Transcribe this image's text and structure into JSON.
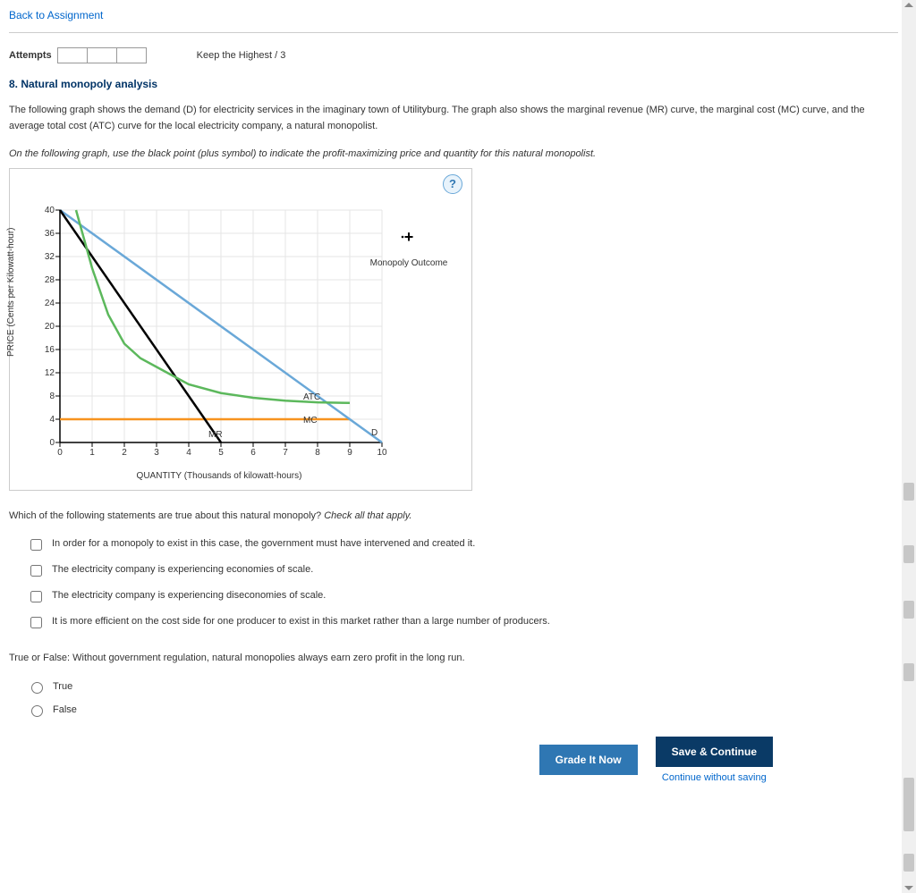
{
  "nav": {
    "back_link": "Back to Assignment"
  },
  "attempts": {
    "label": "Attempts",
    "keep_highest": "Keep the Highest / 3"
  },
  "question": {
    "title": "8. Natural monopoly analysis",
    "para1": "The following graph shows the demand (D) for electricity services in the imaginary town of Utilityburg. The graph also shows the marginal revenue (MR) curve, the marginal cost (MC) curve, and the average total cost (ATC) curve for the local electricity company, a natural monopolist.",
    "instruction": "On the following graph, use the black point (plus symbol) to indicate the profit-maximizing price and quantity for this natural monopolist."
  },
  "chart": {
    "help_symbol": "?",
    "y_label": "PRICE (Cents per Kilowatt-hour)",
    "x_label": "QUANTITY (Thousands of kilowatt-hours)",
    "legend_symbol": "+",
    "legend_label": "Monopoly Outcome",
    "curve_labels": {
      "ATC": "ATC",
      "MC": "MC",
      "MR": "MR",
      "D": "D"
    }
  },
  "chart_data": {
    "type": "line",
    "xlabel": "QUANTITY (Thousands of kilowatt-hours)",
    "ylabel": "PRICE (Cents per Kilowatt-hour)",
    "xlim": [
      0,
      10
    ],
    "ylim": [
      0,
      40
    ],
    "x_ticks": [
      0,
      1,
      2,
      3,
      4,
      5,
      6,
      7,
      8,
      9,
      10
    ],
    "y_ticks": [
      0,
      4,
      8,
      12,
      16,
      20,
      24,
      28,
      32,
      36,
      40
    ],
    "series": [
      {
        "name": "D",
        "color": "#6aa8d8",
        "points": [
          [
            0,
            40
          ],
          [
            10,
            0
          ]
        ]
      },
      {
        "name": "MR",
        "color": "#000000",
        "points": [
          [
            0,
            40
          ],
          [
            5,
            0
          ]
        ]
      },
      {
        "name": "MC",
        "color": "#f7931e",
        "points": [
          [
            0,
            4
          ],
          [
            9,
            4
          ]
        ]
      },
      {
        "name": "ATC",
        "color": "#5cb85c",
        "points": [
          [
            0.5,
            40
          ],
          [
            1,
            30
          ],
          [
            1.5,
            22
          ],
          [
            2,
            17
          ],
          [
            2.5,
            14.5
          ],
          [
            3,
            13
          ],
          [
            3.5,
            11.5
          ],
          [
            4,
            10
          ],
          [
            5,
            8.5
          ],
          [
            6,
            7.7
          ],
          [
            7,
            7.2
          ],
          [
            8,
            6.9
          ],
          [
            9,
            6.8
          ]
        ]
      }
    ]
  },
  "q2": {
    "prompt": "Which of the following statements are true about this natural monopoly? ",
    "hint": "Check all that apply.",
    "choices": [
      "In order for a monopoly to exist in this case, the government must have intervened and created it.",
      "The electricity company is experiencing economies of scale.",
      "The electricity company is experiencing diseconomies of scale.",
      "It is more efficient on the cost side for one producer to exist in this market rather than a large number of producers."
    ]
  },
  "q3": {
    "prompt": "True or False: Without government regulation, natural monopolies always earn zero profit in the long run.",
    "opt_true": "True",
    "opt_false": "False"
  },
  "buttons": {
    "grade": "Grade It Now",
    "save": "Save & Continue",
    "continue_link": "Continue without saving"
  }
}
